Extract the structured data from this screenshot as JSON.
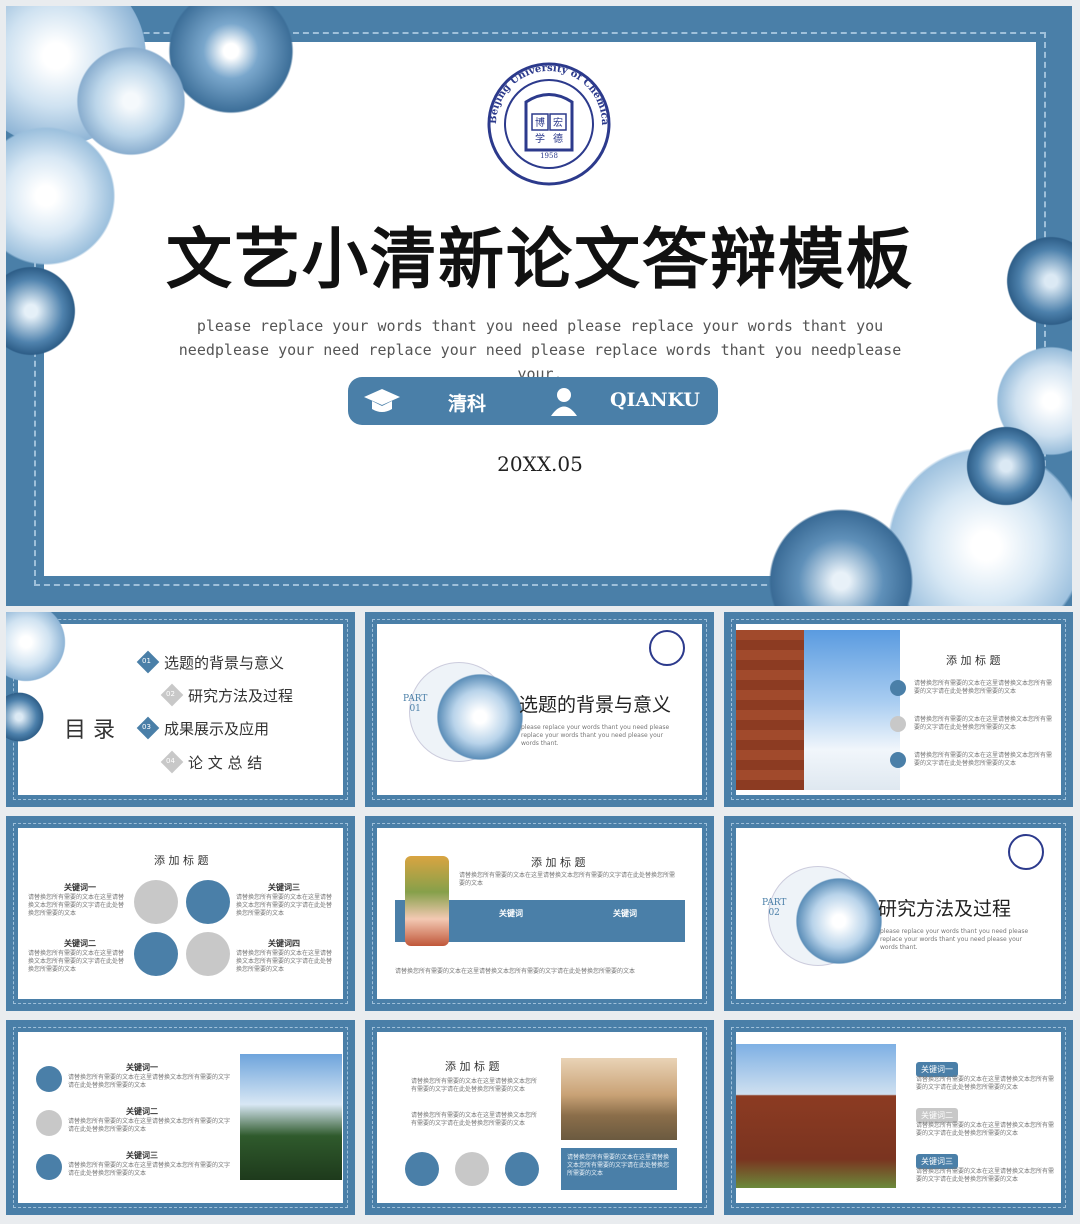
{
  "main": {
    "title": "文艺小清新论文答辩模板",
    "subtitle": "please replace your words thant you need please replace your words thant you needplease your need replace your need please replace words thant you needplease your.",
    "author_label": "清科",
    "company_label": "QIANKU",
    "date": "20XX.05",
    "logo_text": "Beijing University of Chemical Technology",
    "logo_year": "1958",
    "logo_chars": [
      "博",
      "宏",
      "学",
      "德"
    ]
  },
  "toc": {
    "heading": "目 录",
    "items": [
      {
        "num": "01",
        "label": "选题的背景与意义"
      },
      {
        "num": "02",
        "label": "研究方法及过程"
      },
      {
        "num": "03",
        "label": "成果展示及应用"
      },
      {
        "num": "04",
        "label": "论 文 总 结"
      }
    ]
  },
  "part1": {
    "part": "PART",
    "num": "01",
    "title": "选题的背景与意义",
    "desc": "please replace your words thant you need please replace your words thant you need please your words thant."
  },
  "part2": {
    "part": "PART",
    "num": "02",
    "title": "研究方法及过程",
    "desc": "please replace your words thant you need please replace your words thant you need please your words thant."
  },
  "slide3": {
    "title": "添 加 标 题"
  },
  "slide4": {
    "title": "添 加 标 题",
    "keywords": [
      "关键词一",
      "关键词二",
      "关键词三",
      "关键词四"
    ]
  },
  "slide5": {
    "title": "添 加 标 题",
    "kw": [
      "关键词",
      "关键词"
    ]
  },
  "slide7": {
    "keywords": [
      "关键词一",
      "关键词二",
      "关键词三"
    ]
  },
  "slide8": {
    "title": "添 加 标 题"
  },
  "slide9": {
    "tags": [
      "关键词一",
      "关键词二",
      "关键词三"
    ]
  },
  "filler": "请替换您所有需要的文本在这里请替换文本您所有需要的文字请在此处替换您所需要的文本",
  "colors": {
    "primary": "#4a7fa8",
    "light": "#9fc0da",
    "pale": "#dbe8f3"
  }
}
